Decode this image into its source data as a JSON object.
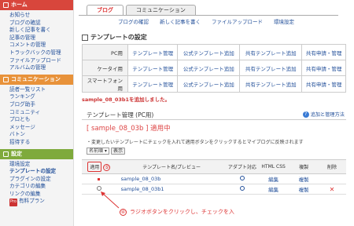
{
  "sidebar": {
    "home": {
      "title": "ホーム",
      "items": [
        "お知らせ",
        "ブログの確認",
        "新しく記事を書く",
        "記事の管理",
        "コメントの管理",
        "トラックバックの管理",
        "ファイルアップロード",
        "アルバムの管理"
      ]
    },
    "community": {
      "title": "コミュニケーション",
      "items": [
        "読者一覧リスト",
        "ランキング",
        "ブログ助手",
        "コミュニティ",
        "プロとも",
        "メッセージ",
        "バトン",
        "招待する"
      ]
    },
    "settings": {
      "title": "設定",
      "items": [
        "環境設定",
        "テンプレートの設定",
        "プラグインの設定",
        "カテゴリの編集",
        "リンクの編集",
        "有料プラン"
      ],
      "current": "テンプレートの設定",
      "pro_badge": "Pro"
    }
  },
  "tabs": [
    "ブログ",
    "コミュニケーション"
  ],
  "subnav": [
    "ブログの確認",
    "新しく記事を書く",
    "ファイルアップロード",
    "環境設定"
  ],
  "panel_title": "テンプレートの設定",
  "grid": {
    "rows": [
      {
        "label": "PC用",
        "links": [
          "テンプレート管理",
          "公式テンプレート追加",
          "共有テンプレート追加",
          "共有申請・管理"
        ]
      },
      {
        "label": "ケータイ用",
        "links": [
          "テンプレート管理",
          "公式テンプレート追加",
          "共有テンプレート追加",
          "共有申請・管理"
        ]
      },
      {
        "label": "スマートフォン用",
        "links": [
          "テンプレート管理",
          "公式テンプレート追加",
          "共有テンプレート追加",
          "共有申請・管理"
        ]
      }
    ]
  },
  "notice": "sample_08_03b1を追加しました。",
  "manager_title": "テンプレート管理 (PC用)",
  "help_link": "追加と管理方法",
  "template_name": "[ sample_08_03b ] 適用中",
  "description": "・変更したいテンプレートにチェックを入れて適用ボタンをクリックするとマイブログに反映されます",
  "sort": {
    "selected": "名前順",
    "button": "表示"
  },
  "list": {
    "headers": [
      "適用",
      "テンプレート名/プレビュー",
      "アダプト対応",
      "HTML CSS",
      "複製",
      "削除"
    ],
    "apply_step": "⑤",
    "rows": [
      {
        "name": "sample_08_03b",
        "html": "編集",
        "copy": "複製",
        "current": true
      },
      {
        "name": "sample_08_03b1",
        "html": "編集",
        "copy": "複製",
        "current": false
      }
    ]
  },
  "annotation": {
    "step": "④",
    "text": "ラジオボタンをクリックし、チェックを入"
  },
  "colors": {
    "accent": "#dd3333",
    "home": "#d8463c",
    "community": "#e8923a",
    "settings": "#7faa3c",
    "link": "#23509a"
  }
}
